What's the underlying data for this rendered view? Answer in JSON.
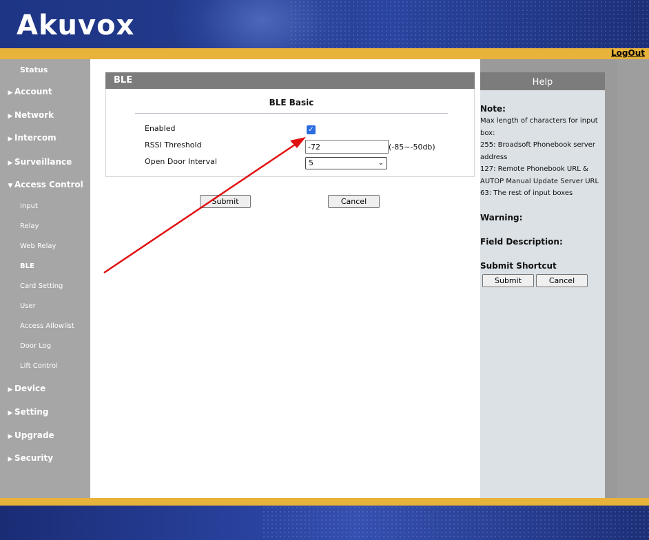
{
  "header": {
    "logo_text": "Akuvox",
    "logout": "LogOut"
  },
  "sidebar": {
    "items": [
      {
        "label": "Status"
      },
      {
        "label": "Account"
      },
      {
        "label": "Network"
      },
      {
        "label": "Intercom"
      },
      {
        "label": "Surveillance"
      },
      {
        "label": "Access Control"
      },
      {
        "label": "Input"
      },
      {
        "label": "Relay"
      },
      {
        "label": "Web Relay"
      },
      {
        "label": "BLE"
      },
      {
        "label": "Card Setting"
      },
      {
        "label": "User"
      },
      {
        "label": "Access Allowlist"
      },
      {
        "label": "Door Log"
      },
      {
        "label": "Lift Control"
      },
      {
        "label": "Device"
      },
      {
        "label": "Setting"
      },
      {
        "label": "Upgrade"
      },
      {
        "label": "Security"
      }
    ]
  },
  "main": {
    "panel_title": "BLE",
    "section_title": "BLE Basic",
    "fields": {
      "enabled_label": "Enabled",
      "enabled_checked": true,
      "rssi_label": "RSSI Threshold",
      "rssi_value": "-72",
      "rssi_range": "(-85~-50db)",
      "interval_label": "Open Door Interval",
      "interval_value": "5"
    },
    "submit_label": "Submit",
    "cancel_label": "Cancel"
  },
  "help": {
    "title": "Help",
    "note_heading": "Note:",
    "note_lines": [
      "Max length of characters for input",
      "box:",
      "255: Broadsoft Phonebook server",
      "address",
      "127: Remote Phonebook URL &",
      "AUTOP Manual Update Server URL",
      "63: The rest of input boxes"
    ],
    "warning_heading": "Warning:",
    "field_desc_heading": "Field Description:",
    "shortcut_heading": "Submit Shortcut",
    "shortcut_submit": "Submit",
    "shortcut_cancel": "Cancel"
  },
  "colors": {
    "gold": "#e8b33a",
    "header_blue": "#233a8c",
    "panel_gray": "#7c7c7c",
    "arrow_red": "#e01010",
    "checkbox_blue": "#2b6de1"
  }
}
